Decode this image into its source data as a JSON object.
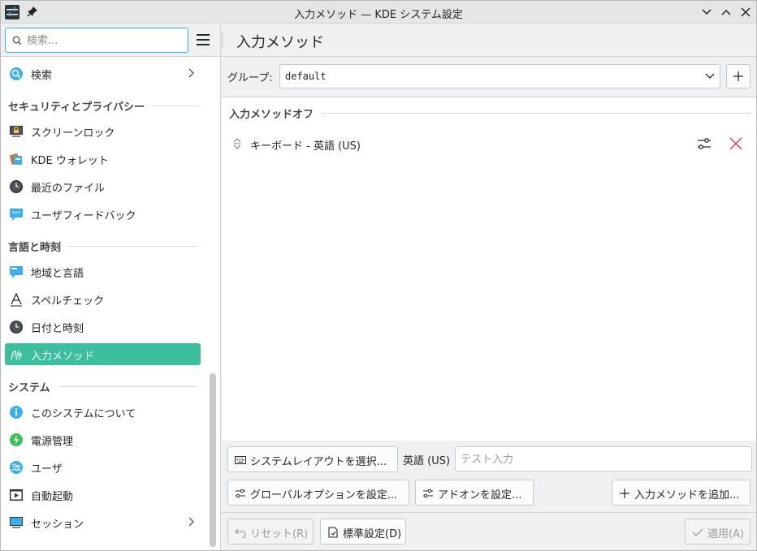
{
  "window": {
    "title": "入力メソッド — KDE システム設定"
  },
  "search": {
    "placeholder": "検索..."
  },
  "sidebar": {
    "items": [
      {
        "label": "検索",
        "icon": "search-icon",
        "has_children": true
      },
      {
        "section": "セキュリティとプライバシー"
      },
      {
        "label": "スクリーンロック",
        "icon": "screen-lock-icon"
      },
      {
        "label": "KDE ウォレット",
        "icon": "wallet-icon"
      },
      {
        "label": "最近のファイル",
        "icon": "clock-icon"
      },
      {
        "label": "ユーザフィードバック",
        "icon": "feedback-icon"
      },
      {
        "section": "言語と時刻"
      },
      {
        "label": "地域と言語",
        "icon": "region-icon"
      },
      {
        "label": "スペルチェック",
        "icon": "spellcheck-icon"
      },
      {
        "label": "日付と時刻",
        "icon": "clock-icon"
      },
      {
        "label": "入力メソッド",
        "icon": "input-method-icon",
        "selected": true
      },
      {
        "section": "システム"
      },
      {
        "label": "このシステムについて",
        "icon": "info-icon"
      },
      {
        "label": "電源管理",
        "icon": "power-icon"
      },
      {
        "label": "ユーザ",
        "icon": "users-icon"
      },
      {
        "label": "自動起動",
        "icon": "autostart-icon"
      },
      {
        "label": "セッション",
        "icon": "session-icon",
        "has_children": true
      }
    ]
  },
  "main": {
    "page_title": "入力メソッド",
    "group_label": "グループ:",
    "group_value": "default",
    "im_group_label": "入力メソッドオフ",
    "im_entry": "キーボード - 英語 (US)",
    "select_layout_button": "システムレイアウトを選択...",
    "layout_label": "英語 (US)",
    "test_input_placeholder": "テスト入力",
    "global_options_button": "グローバルオプションを設定...",
    "addons_button": "アドオンを設定...",
    "add_im_button": "入力メソッドを追加...",
    "reset_button": "リセット(R)",
    "defaults_button": "標準設定(D)",
    "apply_button": "適用(A)"
  },
  "colors": {
    "accent": "#3daee9",
    "selection": "#3bbf9d",
    "remove": "#da4453"
  }
}
